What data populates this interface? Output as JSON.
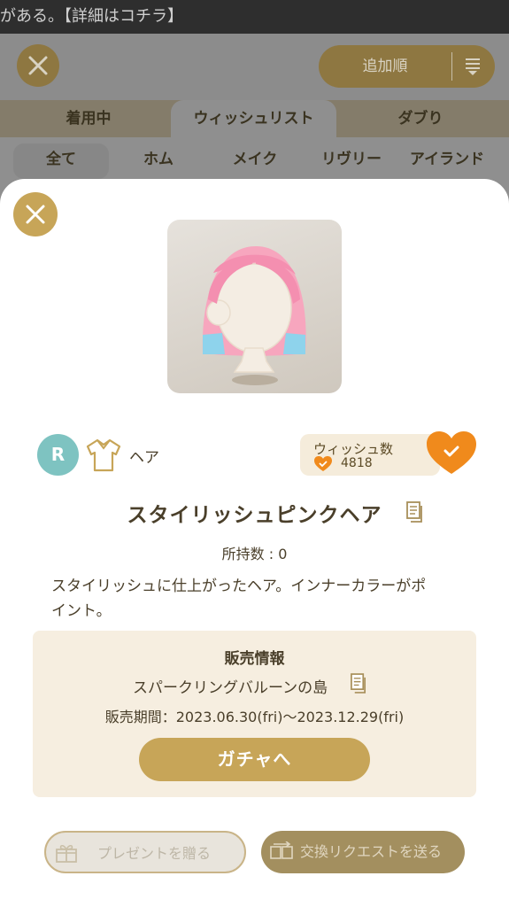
{
  "banner": {
    "text": "がある。【詳細はコチラ】"
  },
  "header": {
    "sort_label": "追加順"
  },
  "tabs": [
    {
      "label": "着用中"
    },
    {
      "label": "ウィッシュリスト",
      "active": true
    },
    {
      "label": "ダブり"
    }
  ],
  "subtabs": [
    {
      "label": "全て",
      "active": true
    },
    {
      "label": "ホム"
    },
    {
      "label": "メイク"
    },
    {
      "label": "リヴリー"
    },
    {
      "label": "アイランド"
    }
  ],
  "item": {
    "rarity": "R",
    "category_icon": "shirt-icon",
    "category": "ヘア",
    "wish_title": "ウィッシュ数",
    "wish_count": "4818",
    "name": "スタイリッシュピンクヘア",
    "owned": "所持数 : 0",
    "description": "スタイリッシュに仕上がったヘア。インナーカラーがポイント。"
  },
  "sales": {
    "title": "販売情報",
    "place": "スパークリングバルーンの島",
    "period": "販売期間：2023.06.30(fri)〜2023.12.29(fri)",
    "gacha_button": "ガチャへ"
  },
  "actions": {
    "present": "プレゼントを贈る",
    "exchange": "交換リクエストを送る"
  },
  "colors": {
    "accent": "#c7a558",
    "wish_heart": "#f08a1c",
    "rarity_badge": "#7ec3c1",
    "sales_bg": "#f6eee0"
  }
}
